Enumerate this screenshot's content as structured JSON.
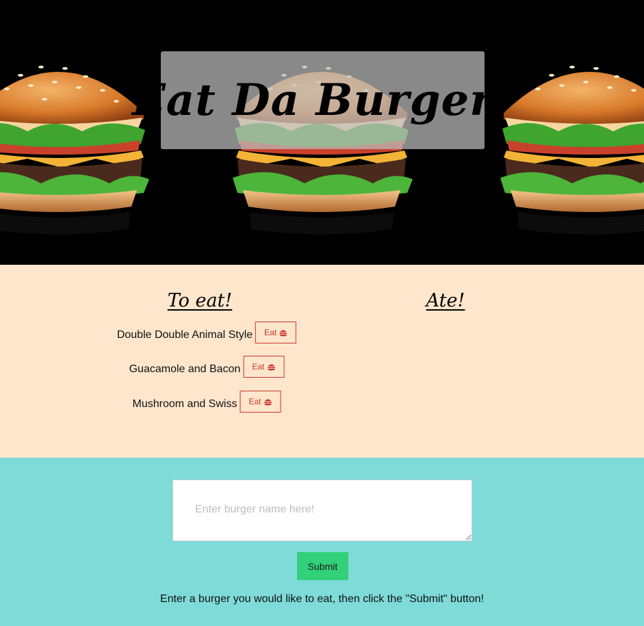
{
  "header": {
    "title": "Eat Da Burger!"
  },
  "lists": {
    "to_eat_heading": "To eat!",
    "ate_heading": "Ate!",
    "to_eat": [
      {
        "name": "Double Double Animal Style",
        "button_label": "Eat"
      },
      {
        "name": "Guacamole and Bacon",
        "button_label": "Eat"
      },
      {
        "name": "Mushroom and Swiss",
        "button_label": "Eat"
      }
    ],
    "ate": []
  },
  "form": {
    "placeholder": "Enter burger name here!",
    "value": "",
    "submit_label": "Submit",
    "hint": "Enter a burger you would like to eat, then click the \"Submit\" button!"
  },
  "colors": {
    "hero_bg": "#000000",
    "lists_bg": "#fde6cc",
    "form_bg": "#7edbd8",
    "eat_button": "#c9352b",
    "submit_button": "#33d07a"
  },
  "icons": {
    "eat_button_icon": "hamburger-icon",
    "hero_image": "burger-photo"
  }
}
